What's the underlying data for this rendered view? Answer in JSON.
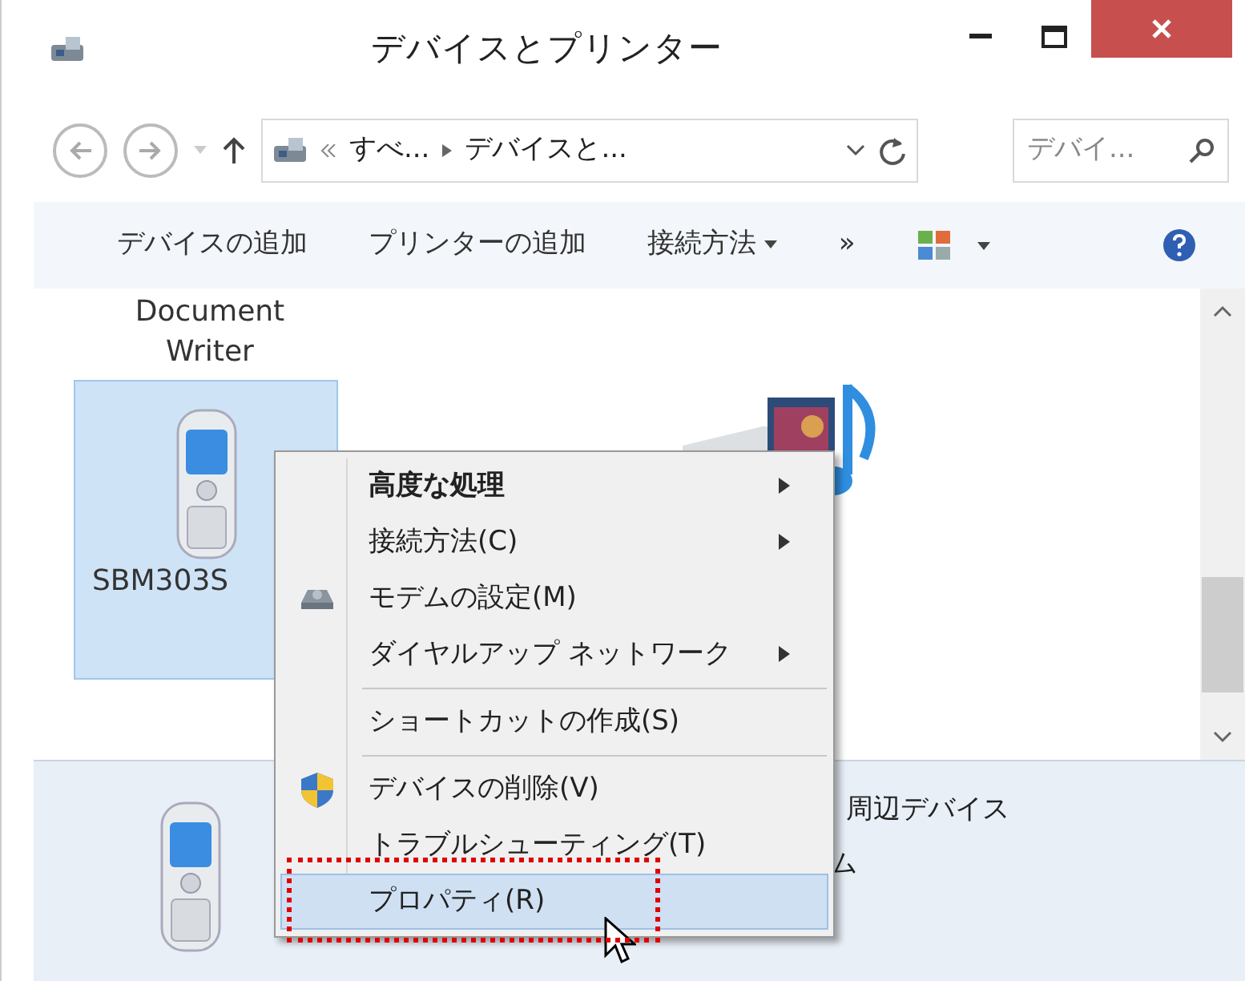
{
  "window": {
    "title": "デバイスとプリンター"
  },
  "address_bar": {
    "crumbs": [
      "すべ...",
      "デバイスと..."
    ],
    "search_placeholder": "デバイ..."
  },
  "toolbar": {
    "items": [
      {
        "kind": "text",
        "label": "デバイスの追加"
      },
      {
        "kind": "text",
        "label": "プリンターの追加"
      },
      {
        "kind": "menu",
        "label": "接続方法"
      },
      {
        "kind": "more",
        "label": "»"
      }
    ]
  },
  "devices": [
    {
      "kind": "label-only",
      "label": "Document Writer",
      "selected": false
    },
    {
      "kind": "phone",
      "label": "SBM303S",
      "selected": true
    },
    {
      "kind": "media",
      "selected": false
    }
  ],
  "details_pane": {
    "lines": [
      "周辺デバイス",
      "ム"
    ]
  },
  "context_menu": {
    "highlight_frame": true,
    "items": [
      {
        "kind": "plain",
        "label": "高度な処理",
        "bold": true,
        "submenu": true,
        "separator_after": false,
        "selected": false
      },
      {
        "kind": "plain",
        "label": "接続方法(C)",
        "bold": false,
        "submenu": true,
        "separator_after": false,
        "selected": false
      },
      {
        "kind": "modem",
        "label": "モデムの設定(M)",
        "bold": false,
        "submenu": false,
        "separator_after": false,
        "selected": false
      },
      {
        "kind": "plain",
        "label": "ダイヤルアップ ネットワーク",
        "bold": false,
        "submenu": true,
        "separator_after": true,
        "selected": false
      },
      {
        "kind": "plain",
        "label": "ショートカットの作成(S)",
        "bold": false,
        "submenu": false,
        "separator_after": true,
        "selected": false
      },
      {
        "kind": "shield",
        "label": "デバイスの削除(V)",
        "bold": false,
        "submenu": false,
        "separator_after": false,
        "selected": false
      },
      {
        "kind": "plain",
        "label": "トラブルシューティング(T)",
        "bold": false,
        "submenu": false,
        "separator_after": false,
        "selected": false
      },
      {
        "kind": "plain",
        "label": "プロパティ(R)",
        "bold": false,
        "submenu": false,
        "separator_after": false,
        "selected": true
      }
    ]
  }
}
